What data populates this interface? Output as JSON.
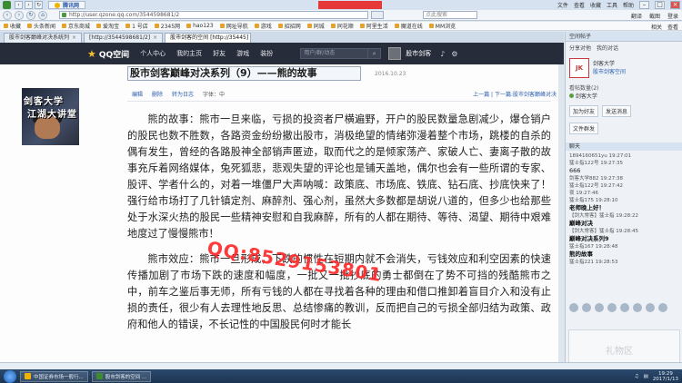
{
  "browser": {
    "title_tab": "腾讯网",
    "title_tab2": "",
    "address": "http://user.qzone.qq.com/3544598681/2",
    "search_placeholder": "点此搜索",
    "right_menu": [
      "文件",
      "查看",
      "收藏",
      "工具",
      "帮助"
    ],
    "nav_right": [
      "翻译",
      "截图",
      "登录"
    ],
    "bookmarks": [
      "收藏",
      "头条新闻",
      "京东商城",
      "爱淘宝",
      "1 号店",
      "2345网",
      "hao123",
      "网址导航",
      "游戏",
      "招招网",
      "同城",
      "同花顺",
      "阿里生活",
      "魔道在线",
      "MM浏览"
    ],
    "bookmark_right": [
      "相关",
      "查看"
    ],
    "tabs": [
      {
        "label": "股市剑客巅峰对决系统列",
        "active": false
      },
      {
        "label": "[http://3544598681/2]",
        "active": false
      },
      {
        "label": "股市剑客的空间 [http://35445]",
        "active": true
      }
    ]
  },
  "qzone": {
    "logo": "QQ空间",
    "menu": [
      "个人中心",
      "我的主页",
      "好友",
      "游戏",
      "装扮"
    ],
    "search_placeholder": "用户/群/动态",
    "user_name": "股市剑客"
  },
  "post": {
    "title": "股市剑客巅峰对决系列（9）——熊的故事",
    "date": "2016.10.23",
    "toolbar": [
      "编辑",
      "删除",
      "转为日志",
      "字体：中"
    ],
    "pager": "上一篇 | 下一篇:股市剑客巅峰对决",
    "paragraphs": [
      "熊的故事：熊市一旦来临，亏损的投资者尸横遍野，开户的股民数量急剧减少，爆仓销户的股民也数不胜数，各路资金纷纷撤出股市，消极绝望的情绪弥漫着整个市场，跳楼的自杀的偶有发生，曾经的各路股神全部销声匿迹，取而代之的是倾家荡产、家破人亡、妻离子散的故事充斥着网络媒体，兔死狐悲，悲观失望的评论也是铺天盖地，偶尔也会有一些所谓的专家、股评、学者什么的，对着一堆僵尸大声呐喊：政策底、市场底、铁底、钻石底、抄底快来了！强行给市场打了几针镇定剂、麻醉剂、强心剂，虽然大多数都是胡说八道的，但多少也给那些处于水深火热的股民一些精神安慰和自我麻醉，所有的人都在期待、等待、渴望、期待中艰难地度过了慢慢熊市！",
      "熊市效应：熊市一旦形成，下跌的惯性在短期内就不会消失，亏钱效应和利空因素的快速传播加剧了市场下跌的速度和幅度，一批又一批抄底的勇士都倒在了势不可挡的残酷熊市之中，前车之鉴后事无师，所有亏钱的人都在寻找着各种的理由和借口推卸着盲目介入和没有止损的责任，很少有人去理性地反思、总结惨痛的教训，反而把自己的亏损全部归结为政策、政府和他人的错误，不长记性的中国股民何时才能长"
    ],
    "avatar_text": [
      "剑客大学",
      "江湖大讲堂"
    ],
    "watermark": "QQ:8529153801"
  },
  "right_panel": {
    "header": "空间帖子",
    "card_name": "剑客大学",
    "card_sub": "股市剑客空间",
    "card_avatar": "JK",
    "tabs_row": [
      "分享对他",
      "我的对话"
    ],
    "list_header": "看帖数量(2)",
    "list_item": "剑客大学",
    "buttons": [
      "加为好友",
      "发送消息",
      "文件群发"
    ],
    "chat_header": "聊天",
    "chat": [
      {
        "meta": "1894160651yu  19:27:01",
        "text": ""
      },
      {
        "meta": "猛士指122号  19:27:35",
        "text": "666"
      },
      {
        "meta": "剑客大学882  19:27:38",
        "text": ""
      },
      {
        "meta": "猛士指122号  19:27:42",
        "text": ""
      },
      {
        "meta": "夜  19:27:46",
        "text": ""
      },
      {
        "meta": "猛士指175  19:28:10",
        "text": "老师晚上好！"
      },
      {
        "meta": "【剑大常客】猛士指  19:28:22",
        "text": "巅峰对决"
      },
      {
        "meta": "【剑大常客】猛士指  19:28:45",
        "text": "巅峰对决系列9"
      },
      {
        "meta": "猛士指167  19:28:48",
        "text": "熊的故事"
      },
      {
        "meta": "猛士指221  19:28:53",
        "text": ""
      }
    ],
    "gift_label": "礼物区"
  },
  "taskbar": {
    "tasks": [
      "中国证券市场一般行...",
      "股市剑客的空间 ..."
    ],
    "time": "19:29",
    "date": "2017/1/13"
  }
}
